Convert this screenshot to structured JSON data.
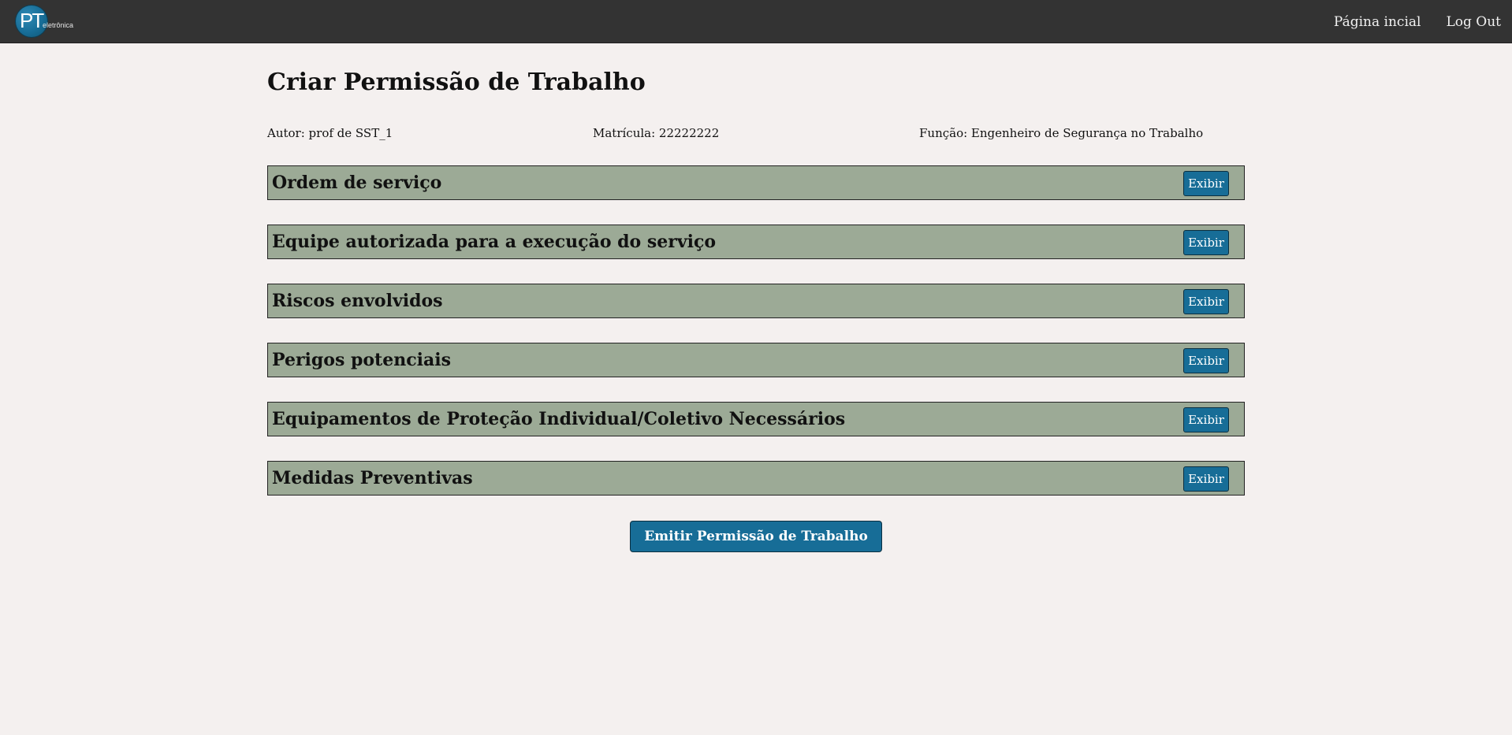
{
  "header": {
    "logo": {
      "main_text": "PT",
      "sub_text": "eletrônica",
      "color": "#176d97"
    },
    "nav": {
      "home_label": "Página incial",
      "logout_label": "Log Out"
    },
    "background_color": "#333333"
  },
  "page": {
    "title": "Criar Permissão de Trabalho",
    "meta": {
      "autor": "Autor: prof de SST_1",
      "matricula": "Matrícula: 22222222",
      "funcao": "Função: Engenheiro de Segurança no Trabalho"
    }
  },
  "sections": [
    {
      "title": "Ordem de serviço",
      "button_label": "Exibir"
    },
    {
      "title": "Equipe autorizada para a execução do serviço",
      "button_label": "Exibir"
    },
    {
      "title": "Riscos envolvidos",
      "button_label": "Exibir"
    },
    {
      "title": "Perigos potenciais",
      "button_label": "Exibir"
    },
    {
      "title": "Equipamentos de Proteção Individual/Coletivo Necessários",
      "button_label": "Exibir"
    },
    {
      "title": "Medidas Preventivas",
      "button_label": "Exibir"
    }
  ],
  "actions": {
    "emit_label": "Emitir Permissão de Trabalho"
  },
  "colors": {
    "page_background": "#f4f0ef",
    "section_background": "#9caa96",
    "button_background": "#176d97"
  }
}
